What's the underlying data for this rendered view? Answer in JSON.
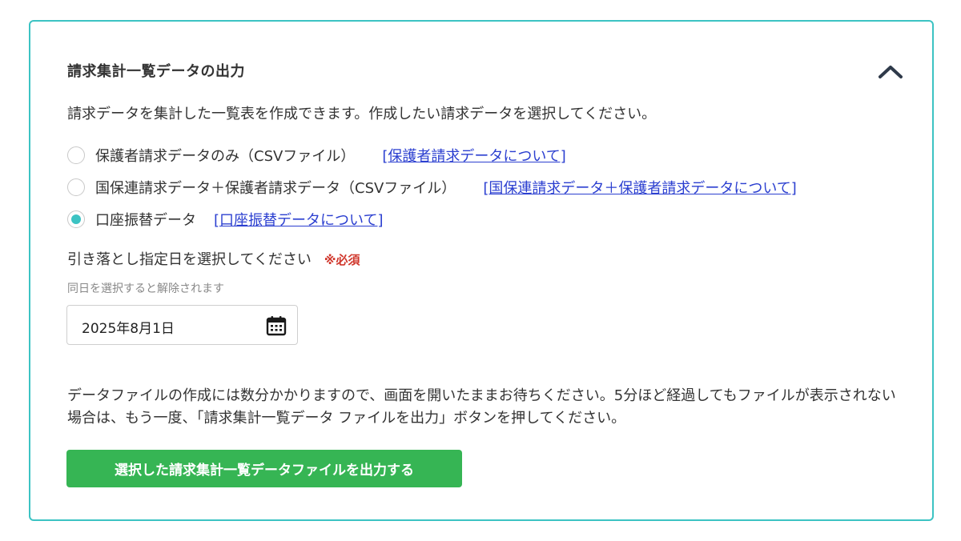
{
  "panel": {
    "title": "請求集計一覧データの出力",
    "collapse_icon": "chevron-up-icon",
    "description": "請求データを集計した一覧表を作成できます。作成したい請求データを選択してください。"
  },
  "options": [
    {
      "label": "保護者請求データのみ（CSVファイル）",
      "link": "[保護者請求データについて]",
      "checked": false
    },
    {
      "label": "国保連請求データ＋保護者請求データ（CSVファイル）",
      "link": "[国保連請求データ＋保護者請求データについて]",
      "checked": false
    },
    {
      "label": "口座振替データ",
      "link": "[口座振替データについて]",
      "checked": true
    }
  ],
  "date_field": {
    "label": "引き落とし指定日を選択してください",
    "required": "※必須",
    "hint": "同日を選択すると解除されます",
    "value": "2025年8月1日",
    "icon": "calendar-icon"
  },
  "notice": "データファイルの作成には数分かかりますので、画面を開いたままお待ちください。5分ほど経過してもファイルが表示されない場合は、もう一度、「請求集計一覧データ ファイルを出力」ボタンを押してください。",
  "submit_label": "選択した請求集計一覧データファイルを出力する",
  "colors": {
    "accent": "#3cc3c3",
    "link": "#2b3fd0",
    "required": "#d0372c",
    "button": "#36b554"
  }
}
